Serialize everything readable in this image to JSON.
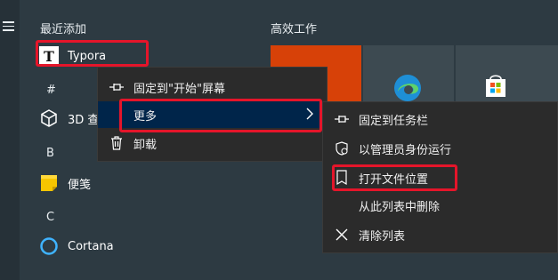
{
  "sections": {
    "recent": "最近添加",
    "hash": "#",
    "b": "B",
    "c": "C"
  },
  "apps": {
    "typora": "Typora",
    "viewer3d": "3D 查",
    "notes": "便笺",
    "cortana": "Cortana"
  },
  "tiles": {
    "group_title": "高效工作"
  },
  "context_menu": {
    "items": [
      {
        "label": "固定到\"开始\"屏幕",
        "icon": "pin-icon"
      },
      {
        "label": "更多",
        "icon": "",
        "submenu": true
      },
      {
        "label": "卸载",
        "icon": "trash-icon"
      }
    ]
  },
  "submenu": {
    "items": [
      {
        "label": "固定到任务栏",
        "icon": "pin-icon"
      },
      {
        "label": "以管理员身份运行",
        "icon": "shield-icon"
      },
      {
        "label": "打开文件位置",
        "icon": "open-file-icon"
      },
      {
        "label": "从此列表中删除",
        "icon": ""
      },
      {
        "label": "清除列表",
        "icon": "close-icon"
      }
    ]
  },
  "colors": {
    "highlight": "#e5152a",
    "selected": "#00254a",
    "tile_orange": "#d74108",
    "tile_gray": "#3d4a51",
    "background": "#2d3a42"
  }
}
